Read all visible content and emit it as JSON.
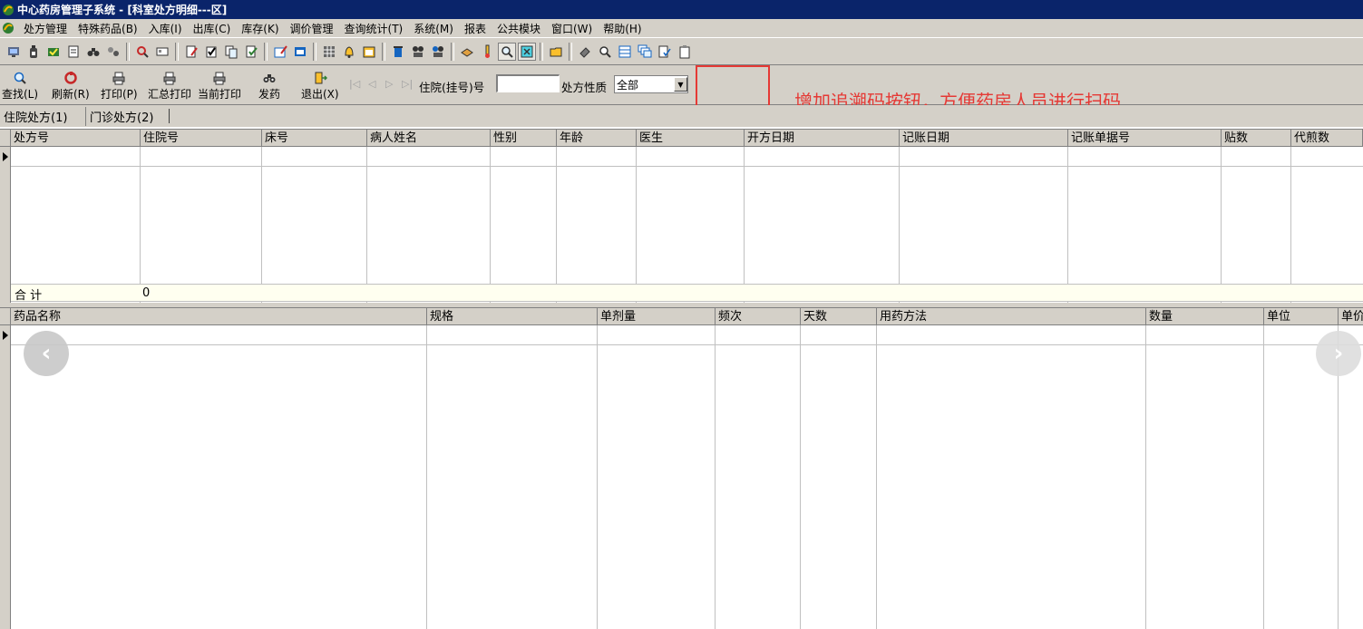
{
  "window": {
    "title": "中心药房管理子系统 - [科室处方明细---区]"
  },
  "menu": [
    "处方管理",
    "特殊药品(B)",
    "入库(I)",
    "出库(C)",
    "库存(K)",
    "调价管理",
    "查询统计(T)",
    "系统(M)",
    "报表",
    "公共模块",
    "窗口(W)",
    "帮助(H)"
  ],
  "toolbar_buttons": [
    {
      "label": "查找(L)",
      "icon": "magnifier-icon"
    },
    {
      "label": "刷新(R)",
      "icon": "refresh-icon"
    },
    {
      "label": "打印(P)",
      "icon": "printer-icon"
    },
    {
      "label": "汇总打印",
      "icon": "printer-icon"
    },
    {
      "label": "当前打印",
      "icon": "printer-icon"
    },
    {
      "label": "发药",
      "icon": "binoculars-icon"
    },
    {
      "label": "退出(X)",
      "icon": "exit-door-icon"
    }
  ],
  "filters": {
    "admission_label": "住院(挂号)号",
    "admission_value": "",
    "rx_type_label": "处方性质",
    "rx_type_value": "全部"
  },
  "annotation": {
    "text": "增加追溯码按钮，方便药房人员进行扫码",
    "color": "#e53935"
  },
  "tabs": [
    "住院处方(1)",
    "门诊处方(2)"
  ],
  "prescriptions": {
    "columns": [
      "处方号",
      "住院号",
      "床号",
      "病人姓名",
      "性别",
      "年龄",
      "医生",
      "开方日期",
      "记账日期",
      "记账单据号",
      "贴数",
      "代煎数"
    ],
    "rows": [],
    "summary_label": "合  计",
    "summary_value": "0"
  },
  "details": {
    "columns": [
      "药品名称",
      "规格",
      "单剂量",
      "频次",
      "天数",
      "用药方法",
      "数量",
      "单位",
      "单价"
    ],
    "rows": []
  },
  "overlay": {
    "prev_glyph": "‹",
    "next_glyph": "›"
  }
}
